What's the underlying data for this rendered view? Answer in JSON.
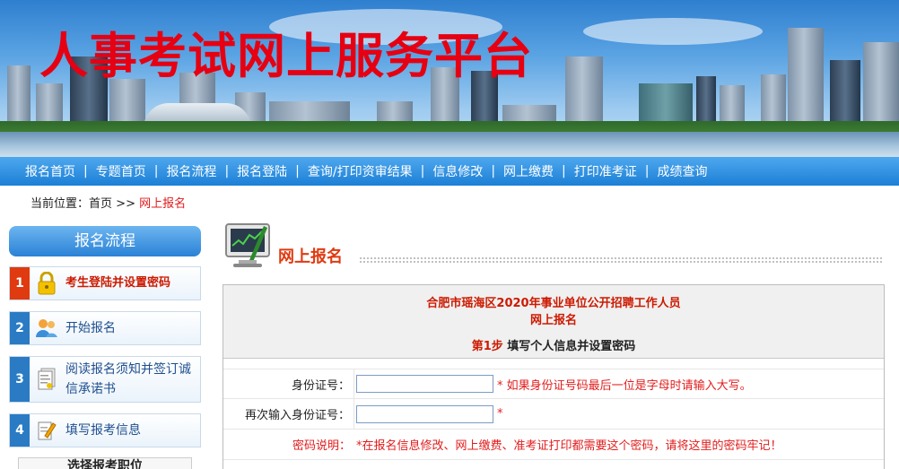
{
  "banner": {
    "title": "人事考试网上服务平台"
  },
  "nav": {
    "items": [
      {
        "label": "报名首页"
      },
      {
        "label": "专题首页"
      },
      {
        "label": "报名流程"
      },
      {
        "label": "报名登陆"
      },
      {
        "label": "查询/打印资审结果"
      },
      {
        "label": "信息修改"
      },
      {
        "label": "网上缴费"
      },
      {
        "label": "打印准考证"
      },
      {
        "label": "成绩查询"
      }
    ],
    "separator": "|"
  },
  "breadcrumb": {
    "prefix": "当前位置：",
    "home": "首页",
    "arrow": ">>",
    "current": "网上报名"
  },
  "sidebar": {
    "heading": "报名流程",
    "steps": [
      {
        "num": "1",
        "label": "考生登陆并设置密码",
        "icon": "lock-icon",
        "active": true
      },
      {
        "num": "2",
        "label": "开始报名",
        "icon": "users-icon",
        "active": false
      },
      {
        "num": "3",
        "label": "阅读报名须知并签订诚信承诺书",
        "icon": "document-icon",
        "active": false
      },
      {
        "num": "4",
        "label": "填写报考信息",
        "icon": "edit-icon",
        "active": false
      },
      {
        "num": "",
        "label": "选择报考职位",
        "icon": "",
        "active": false
      }
    ]
  },
  "main": {
    "section_title": "网上报名",
    "org_title": "合肥市瑶海区2020年事业单位公开招聘工作人员",
    "sub_title": "网上报名",
    "step_prefix": "第1步",
    "step_text": "填写个人信息并设置密码",
    "form": {
      "id_label": "身份证号：",
      "id_value": "",
      "id_hint": "* 如果身份证号码最后一位是字母时请输入大写。",
      "id2_label": "再次输入身份证号：",
      "id2_value": "",
      "id2_hint": "*",
      "pwd_label": "密码说明：",
      "pwd_hint": "*在报名信息修改、网上缴费、准考证打印都需要这个密码，请将这里的密码牢记！"
    }
  },
  "colors": {
    "accent_red": "#e21c1c",
    "nav_blue": "#1c7fd6",
    "step_active": "#e03a10"
  }
}
